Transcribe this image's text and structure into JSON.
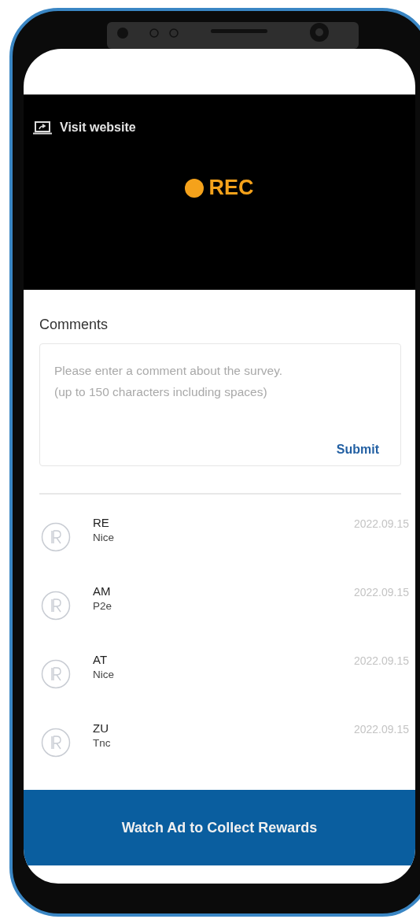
{
  "header": {
    "link": "Visit website",
    "rec": "REC"
  },
  "comments": {
    "title": "Comments",
    "placeholder": "Please enter a comment about the survey.\n(up to 150 characters including spaces)",
    "submit": "Submit"
  },
  "list": [
    {
      "name": "RE",
      "text": "Nice",
      "date": "2022.09.15"
    },
    {
      "name": "AM",
      "text": "P2e",
      "date": "2022.09.15"
    },
    {
      "name": "AT",
      "text": "Nice",
      "date": "2022.09.15"
    },
    {
      "name": "ZU",
      "text": "Tnc",
      "date": "2022.09.15"
    }
  ],
  "action_button": "Watch Ad to Collect Rewards"
}
